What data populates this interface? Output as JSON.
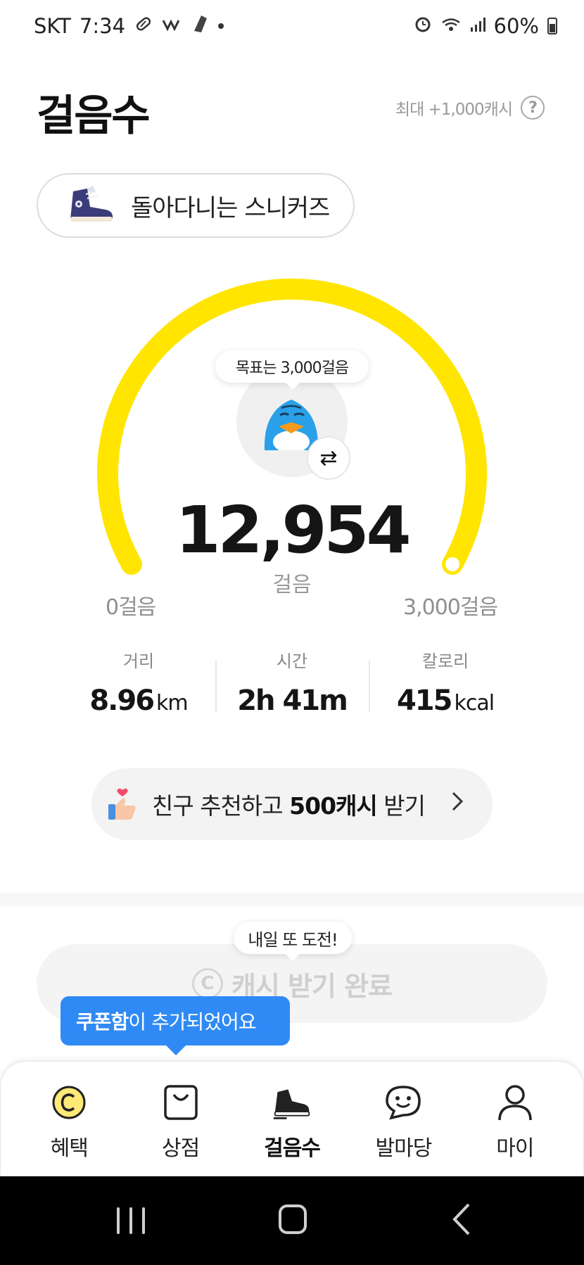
{
  "status_bar": {
    "carrier": "SKT",
    "time": "7:34",
    "battery": "60%",
    "icons": [
      "pill-icon",
      "app-icon",
      "shoe-icon",
      "dot-icon",
      "alarm-icon",
      "wifi-icon",
      "signal-icon",
      "battery-icon"
    ]
  },
  "header": {
    "title": "걸음수",
    "max_reward": "최대 +1,000캐시",
    "help_icon": "?"
  },
  "sneaker": {
    "label": "돌아다니는 스니커즈",
    "icon": "sneaker-icon"
  },
  "gauge": {
    "goal_text": "목표는 3,000걸음",
    "steps": "12,954",
    "steps_unit": "걸음",
    "min_label": "0걸음",
    "max_label": "3,000걸음",
    "progress": 1.0,
    "color": "#FFE500",
    "swap_icon": "⇄"
  },
  "stats": [
    {
      "label": "거리",
      "value": "8.96",
      "unit": "km"
    },
    {
      "label": "시간",
      "value": "2h 41m",
      "unit": ""
    },
    {
      "label": "칼로리",
      "value": "415",
      "unit": "kcal"
    }
  ],
  "referral": {
    "prefix": "친구 추천하고 ",
    "highlight": "500캐시",
    "suffix": " 받기",
    "chevron": ">"
  },
  "complete": {
    "bubble": "내일 또 도전!",
    "coin_symbol": "C",
    "label": "캐시 받기 완료"
  },
  "coupon_toast": {
    "highlight": "쿠폰함",
    "text": "이 추가되었어요",
    "color": "#2F8AF5"
  },
  "bottom_nav": [
    {
      "label": "혜택",
      "icon": "coin-icon"
    },
    {
      "label": "상점",
      "icon": "shopping-bag-icon"
    },
    {
      "label": "걸음수",
      "icon": "sneaker-nav-icon",
      "active": true
    },
    {
      "label": "발마당",
      "icon": "chat-smile-icon"
    },
    {
      "label": "마이",
      "icon": "person-icon"
    }
  ]
}
